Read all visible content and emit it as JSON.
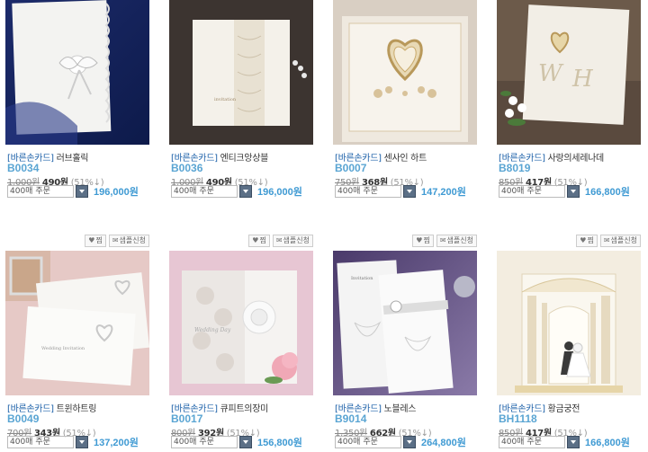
{
  "products": [
    {
      "brand": "[바른손카드]",
      "name": "러브홀릭",
      "code": "B0034",
      "old_price": "1,000원",
      "price": "490원",
      "discount": "(51%↓)",
      "qty": "400매 주문",
      "total": "196,000원"
    },
    {
      "brand": "[바른손카드]",
      "name": "엔티크앙상블",
      "code": "B0036",
      "old_price": "1,000원",
      "price": "490원",
      "discount": "(51%↓)",
      "qty": "400매 주문",
      "total": "196,000원"
    },
    {
      "brand": "[바른손카드]",
      "name": "센사인 하트",
      "code": "B0007",
      "old_price": "750원",
      "price": "368원",
      "discount": "(51%↓)",
      "qty": "400매 주문",
      "total": "147,200원"
    },
    {
      "brand": "[바른손카드]",
      "name": "사랑의세레나데",
      "code": "B8019",
      "old_price": "850원",
      "price": "417원",
      "discount": "(51%↓)",
      "qty": "400매 주문",
      "total": "166,800원"
    },
    {
      "brand": "[바른손카드]",
      "name": "트윈하트링",
      "code": "B0049",
      "old_price": "700원",
      "price": "343원",
      "discount": "(51%↓)",
      "qty": "400매 주문",
      "total": "137,200원",
      "actions": {
        "wish": "찜",
        "sample": "샘플신청"
      }
    },
    {
      "brand": "[바른손카드]",
      "name": "큐피트의장미",
      "code": "B0017",
      "old_price": "800원",
      "price": "392원",
      "discount": "(51%↓)",
      "qty": "400매 주문",
      "total": "156,800원",
      "actions": {
        "wish": "찜",
        "sample": "샘플신청"
      }
    },
    {
      "brand": "[바른손카드]",
      "name": "노블레스",
      "code": "B9014",
      "old_price": "1,350원",
      "price": "662원",
      "discount": "(51%↓)",
      "qty": "400매 주문",
      "total": "264,800원",
      "actions": {
        "wish": "찜",
        "sample": "샘플신청"
      }
    },
    {
      "brand": "[바른손카드]",
      "name": "황금궁전",
      "code": "BH1118",
      "old_price": "850원",
      "price": "417원",
      "discount": "(51%↓)",
      "qty": "400매 주문",
      "total": "166,800원",
      "actions": {
        "wish": "찜",
        "sample": "샘플신청"
      }
    }
  ],
  "icons": {
    "wish": "heart-icon",
    "sample": "envelope-icon",
    "dropdown": "chevron-down-icon"
  }
}
